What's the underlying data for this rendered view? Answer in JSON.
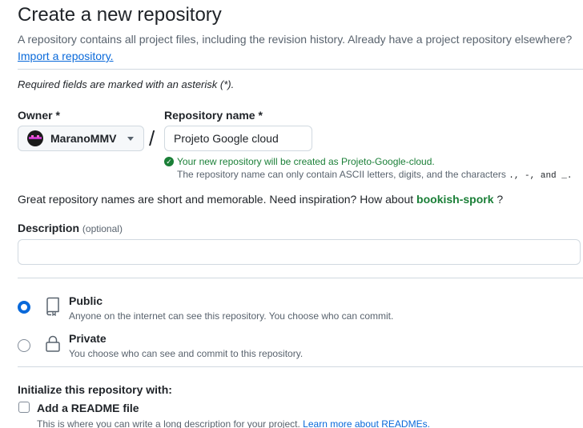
{
  "header": {
    "title": "Create a new repository",
    "subtitle": "A repository contains all project files, including the revision history. Already have a project repository elsewhere?",
    "import_link": "Import a repository."
  },
  "form": {
    "required_note": "Required fields are marked with an asterisk (*).",
    "owner_label": "Owner *",
    "owner_value": "MaranoMMV",
    "separator": "/",
    "repo_label": "Repository name *",
    "repo_value": "Projeto Google cloud",
    "availability_message": "Your new repository will be created as Projeto-Google-cloud.",
    "rules_prefix": "The repository name can only contain ASCII letters, digits, and the characters",
    "rules_chars": ".,  -,  and  _.",
    "inspiration_text": "Great repository names are short and memorable. Need inspiration? How about",
    "suggestion": "bookish-spork",
    "inspiration_suffix": "?",
    "description_label": "Description",
    "description_optional": "(optional)",
    "description_value": ""
  },
  "visibility": {
    "options": [
      {
        "title": "Public",
        "desc": "Anyone on the internet can see this repository. You choose who can commit.",
        "selected": true,
        "icon": "repo-icon"
      },
      {
        "title": "Private",
        "desc": "You choose who can see and commit to this repository.",
        "selected": false,
        "icon": "lock-icon"
      }
    ]
  },
  "initialize": {
    "title": "Initialize this repository with:",
    "readme_label": "Add a README file",
    "readme_desc": "This is where you can write a long description for your project.",
    "readme_link": "Learn more about READMEs."
  },
  "colors": {
    "accent": "#0969da",
    "success": "#1a7f37",
    "border": "#d1d9e0",
    "muted": "#59636e"
  }
}
